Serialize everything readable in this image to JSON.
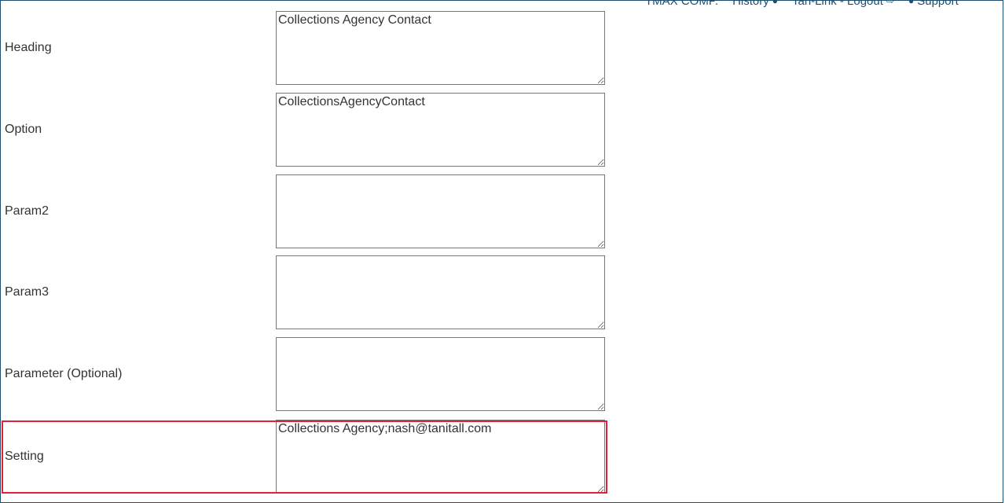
{
  "nav": {
    "company": "TMAX COMP.",
    "history": "History",
    "logout": "Tan-Link - Logout",
    "support": "Support"
  },
  "fields": [
    {
      "label": "Heading",
      "value": "Collections Agency Contact"
    },
    {
      "label": "Option",
      "value": "CollectionsAgencyContact"
    },
    {
      "label": "Param2",
      "value": ""
    },
    {
      "label": "Param3",
      "value": ""
    },
    {
      "label": "Parameter (Optional)",
      "value": ""
    },
    {
      "label": "Setting",
      "value": "Collections Agency;nash@tanitall.com"
    }
  ],
  "highlight_color": "#e3203a",
  "border_color": "#1d4f70"
}
